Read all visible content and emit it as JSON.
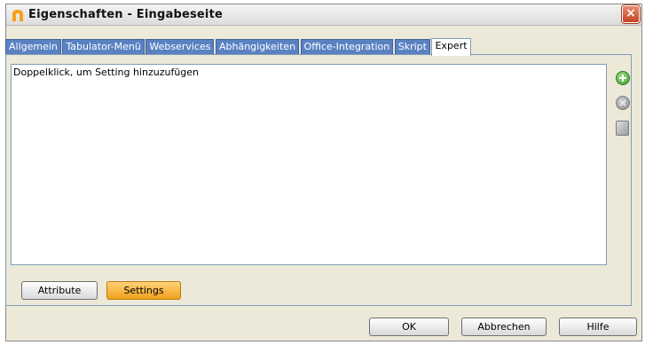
{
  "window": {
    "title": "Eigenschaften - Eingabeseite",
    "close_label": "×"
  },
  "tabs": [
    {
      "label": "Allgemein",
      "active": false
    },
    {
      "label": "Tabulator-Menü",
      "active": false
    },
    {
      "label": "Webservices",
      "active": false
    },
    {
      "label": "Abhängigkeiten",
      "active": false
    },
    {
      "label": "Office-Integration",
      "active": false
    },
    {
      "label": "Skript",
      "active": false
    },
    {
      "label": "Expert",
      "active": true
    }
  ],
  "settings_list": {
    "hint": "Doppelklick, um Setting hinzuzufügen"
  },
  "side_icons": [
    "add-icon",
    "remove-icon",
    "page-icon"
  ],
  "mode_buttons": {
    "attribute_label": "Attribute",
    "settings_label": "Settings"
  },
  "dialog_buttons": {
    "ok_label": "OK",
    "cancel_label": "Abbrechen",
    "help_label": "Hilfe"
  },
  "colors": {
    "tab_inactive": "#5a82c2",
    "settings_button": "#f0a01a",
    "add_icon": "#3c9a2a"
  }
}
